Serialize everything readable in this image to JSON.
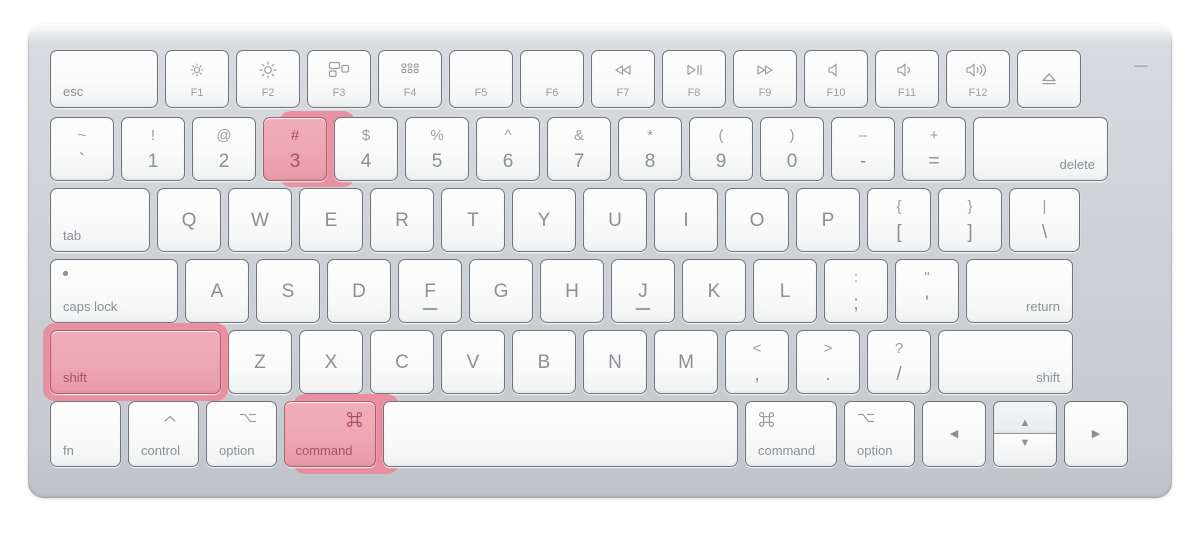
{
  "device": {
    "name": "Apple Magic Keyboard",
    "body_color": "#cdd1d5",
    "key_color": "#fafafa",
    "legend_color": "#8b9096",
    "highlight_fill": "#eda7b3",
    "highlight_border": "#b9566a",
    "highlight_halo": "#e9879a",
    "highlight_text": "#a8506a"
  },
  "shortcut": {
    "keys": [
      "shift",
      "command",
      "3"
    ],
    "highlighted": [
      "shift-left",
      "command-left",
      "key-3"
    ]
  },
  "rows": {
    "function_row": [
      {
        "id": "esc",
        "name": "escape-key",
        "label": "esc",
        "width": "w-esc",
        "style": "anchor-bl"
      },
      {
        "id": "f1",
        "name": "brightness-down-key",
        "fn": "F1",
        "icon": "brightness-low-icon"
      },
      {
        "id": "f2",
        "name": "brightness-up-key",
        "fn": "F2",
        "icon": "brightness-high-icon"
      },
      {
        "id": "f3",
        "name": "mission-control-key",
        "fn": "F3",
        "icon": "mission-control-icon"
      },
      {
        "id": "f4",
        "name": "launchpad-key",
        "fn": "F4",
        "icon": "launchpad-icon"
      },
      {
        "id": "f5",
        "name": "f5-key",
        "fn": "F5",
        "icon": "none"
      },
      {
        "id": "f6",
        "name": "f6-key",
        "fn": "F6",
        "icon": "none"
      },
      {
        "id": "f7",
        "name": "rewind-key",
        "fn": "F7",
        "icon": "rewind-icon"
      },
      {
        "id": "f8",
        "name": "play-pause-key",
        "fn": "F8",
        "icon": "play-pause-icon"
      },
      {
        "id": "f9",
        "name": "fast-forward-key",
        "fn": "F9",
        "icon": "fast-forward-icon"
      },
      {
        "id": "f10",
        "name": "mute-key",
        "fn": "F10",
        "icon": "volume-mute-icon"
      },
      {
        "id": "f11",
        "name": "volume-down-key",
        "fn": "F11",
        "icon": "volume-down-icon"
      },
      {
        "id": "f12",
        "name": "volume-up-key",
        "fn": "F12",
        "icon": "volume-up-icon"
      },
      {
        "id": "eject",
        "name": "eject-key",
        "width": "w-eject",
        "icon": "eject-icon"
      }
    ],
    "number_row": [
      {
        "id": "grave",
        "name": "grave-key",
        "top": "~",
        "bottom": "`"
      },
      {
        "id": "1",
        "name": "one-key",
        "top": "!",
        "bottom": "1"
      },
      {
        "id": "2",
        "name": "two-key",
        "top": "@",
        "bottom": "2"
      },
      {
        "id": "3",
        "name": "three-key",
        "top": "#",
        "bottom": "3",
        "highlight": true
      },
      {
        "id": "4",
        "name": "four-key",
        "top": "$",
        "bottom": "4"
      },
      {
        "id": "5",
        "name": "five-key",
        "top": "%",
        "bottom": "5"
      },
      {
        "id": "6",
        "name": "six-key",
        "top": "^",
        "bottom": "6"
      },
      {
        "id": "7",
        "name": "seven-key",
        "top": "&",
        "bottom": "7"
      },
      {
        "id": "8",
        "name": "eight-key",
        "top": "*",
        "bottom": "8"
      },
      {
        "id": "9",
        "name": "nine-key",
        "top": "(",
        "bottom": "9"
      },
      {
        "id": "0",
        "name": "zero-key",
        "top": ")",
        "bottom": "0"
      },
      {
        "id": "minus",
        "name": "minus-key",
        "top": "–",
        "bottom": "-"
      },
      {
        "id": "equal",
        "name": "equals-key",
        "top": "+",
        "bottom": "="
      },
      {
        "id": "delete",
        "name": "delete-key",
        "label": "delete",
        "width": "w-delete",
        "style": "anchor-br"
      }
    ],
    "top_row": [
      {
        "id": "tab",
        "name": "tab-key",
        "label": "tab",
        "width": "w-tab",
        "style": "anchor-bl"
      },
      {
        "id": "q",
        "name": "q-key",
        "main": "Q"
      },
      {
        "id": "w",
        "name": "w-key",
        "main": "W"
      },
      {
        "id": "e",
        "name": "e-key",
        "main": "E"
      },
      {
        "id": "r",
        "name": "r-key",
        "main": "R"
      },
      {
        "id": "t",
        "name": "t-key",
        "main": "T"
      },
      {
        "id": "y",
        "name": "y-key",
        "main": "Y"
      },
      {
        "id": "u",
        "name": "u-key",
        "main": "U"
      },
      {
        "id": "i",
        "name": "i-key",
        "main": "I"
      },
      {
        "id": "o",
        "name": "o-key",
        "main": "O"
      },
      {
        "id": "p",
        "name": "p-key",
        "main": "P"
      },
      {
        "id": "lbracket",
        "name": "left-bracket-key",
        "top": "{",
        "bottom": "["
      },
      {
        "id": "rbracket",
        "name": "right-bracket-key",
        "top": "}",
        "bottom": "]"
      },
      {
        "id": "backslash",
        "name": "backslash-key",
        "top": "|",
        "bottom": "\\",
        "width": "w-backsl"
      }
    ],
    "home_row": [
      {
        "id": "caps",
        "name": "caps-lock-key",
        "label": "caps lock",
        "width": "w-caps",
        "style": "anchor-bl",
        "led": true
      },
      {
        "id": "a",
        "name": "a-key",
        "main": "A"
      },
      {
        "id": "s",
        "name": "s-key",
        "main": "S"
      },
      {
        "id": "d",
        "name": "d-key",
        "main": "D"
      },
      {
        "id": "f",
        "name": "f-key",
        "main": "F",
        "homing": true
      },
      {
        "id": "g",
        "name": "g-key",
        "main": "G"
      },
      {
        "id": "h",
        "name": "h-key",
        "main": "H"
      },
      {
        "id": "j",
        "name": "j-key",
        "main": "J",
        "homing": true
      },
      {
        "id": "k",
        "name": "k-key",
        "main": "K"
      },
      {
        "id": "l",
        "name": "l-key",
        "main": "L"
      },
      {
        "id": "semicolon",
        "name": "semicolon-key",
        "top": ":",
        "bottom": ";"
      },
      {
        "id": "quote",
        "name": "quote-key",
        "top": "\"",
        "bottom": "'"
      },
      {
        "id": "return",
        "name": "return-key",
        "label": "return",
        "width": "w-return",
        "style": "anchor-br"
      }
    ],
    "shift_row": [
      {
        "id": "lshift",
        "name": "left-shift-key",
        "label": "shift",
        "width": "w-lshift",
        "style": "anchor-bl",
        "highlight": true
      },
      {
        "id": "z",
        "name": "z-key",
        "main": "Z"
      },
      {
        "id": "x",
        "name": "x-key",
        "main": "X"
      },
      {
        "id": "c",
        "name": "c-key",
        "main": "C"
      },
      {
        "id": "v",
        "name": "v-key",
        "main": "V"
      },
      {
        "id": "b",
        "name": "b-key",
        "main": "B"
      },
      {
        "id": "n",
        "name": "n-key",
        "main": "N"
      },
      {
        "id": "m",
        "name": "m-key",
        "main": "M"
      },
      {
        "id": "comma",
        "name": "comma-key",
        "top": "<",
        "bottom": ","
      },
      {
        "id": "period",
        "name": "period-key",
        "top": ">",
        "bottom": "."
      },
      {
        "id": "slash",
        "name": "slash-key",
        "top": "?",
        "bottom": "/"
      },
      {
        "id": "rshift",
        "name": "right-shift-key",
        "label": "shift",
        "width": "w-rshift",
        "style": "anchor-br"
      }
    ],
    "bottom_row": [
      {
        "id": "fn",
        "name": "fn-key",
        "label": "fn",
        "width": "w-fn",
        "style": "anchor-bl"
      },
      {
        "id": "control",
        "name": "control-key",
        "label": "control",
        "width": "w-ctrl",
        "glyph": "control-glyph"
      },
      {
        "id": "loption",
        "name": "left-option-key",
        "label": "option",
        "width": "w-opt",
        "glyph": "option-glyph"
      },
      {
        "id": "lcommand",
        "name": "left-command-key",
        "label": "command",
        "width": "w-cmd",
        "glyph": "command-glyph",
        "highlight": true
      },
      {
        "id": "space",
        "name": "space-key",
        "label": "",
        "width": "w-space"
      },
      {
        "id": "rcommand",
        "name": "right-command-key",
        "label": "command",
        "width": "w-rcmd",
        "glyph": "command-glyph",
        "align": "left"
      },
      {
        "id": "roption",
        "name": "right-option-key",
        "label": "option",
        "width": "w-ropt",
        "glyph": "option-glyph",
        "align": "left"
      },
      {
        "id": "left",
        "name": "arrow-left-key",
        "width": "w-arrow",
        "arrow": "◀"
      },
      {
        "id": "updown",
        "name": "arrow-up-down-keys",
        "width": "w-arrow",
        "arrow_up": "▲",
        "arrow_down": "▼"
      },
      {
        "id": "right",
        "name": "arrow-right-key",
        "width": "w-arrow",
        "arrow": "▶"
      }
    ]
  }
}
